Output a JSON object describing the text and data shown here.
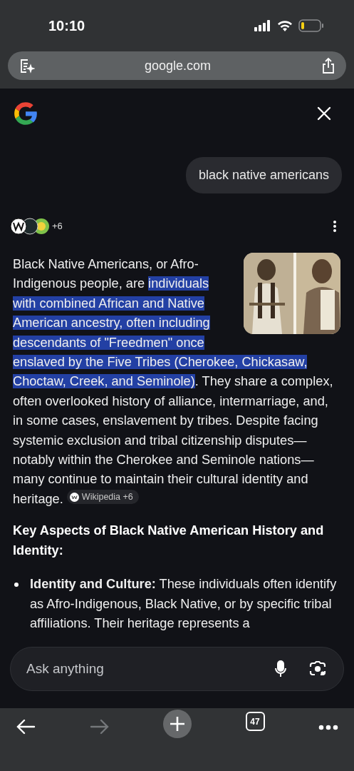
{
  "status_bar": {
    "time": "10:10"
  },
  "address_bar": {
    "url": "google.com"
  },
  "query": "black native americans",
  "sources": {
    "count": "+6"
  },
  "answer": {
    "segments": [
      {
        "text": "Black Native Americans, or Afro-Indigenous people, are ",
        "highlighted": false
      },
      {
        "text": "individuals with combined African and Native American ancestry, often including descendants of \"Freedmen\" once enslaved by the Five Tribes (Cherokee, Chickasaw, Choctaw, Creek, and Seminole)",
        "highlighted": true
      },
      {
        "text": ". They share a complex, often overlooked history of alliance, intermarriage, and, in some cases, enslavement by tribes. Despite facing systemic exclusion and tribal citizenship disputes—notably within the Cherokee and Seminole nations—many continue to maintain their cultural identity and heritage.",
        "highlighted": false
      }
    ],
    "citation": "Wikipedia +6",
    "heading": "Key Aspects of Black Native American History and Identity:",
    "bullets": [
      {
        "text": "**Identity and Culture:** These individuals often identify as Afro-Indigenous, Black Native, or by specific tribal affiliations. Their heritage represents a"
      }
    ]
  },
  "ask_bar": {
    "placeholder": "Ask anything"
  },
  "toolbar": {
    "tab_count": "47",
    "forward_disabled": true
  }
}
